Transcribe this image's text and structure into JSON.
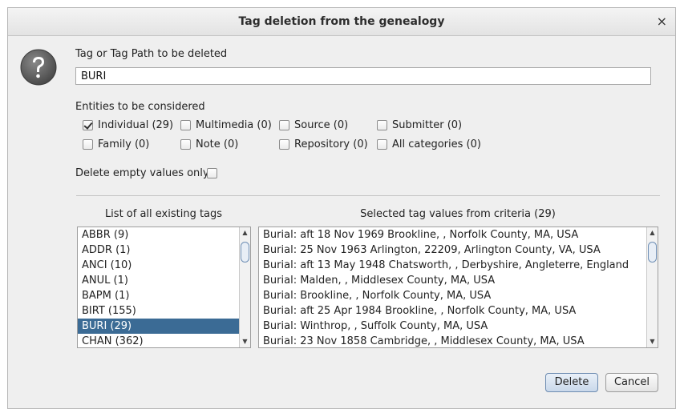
{
  "dialog": {
    "title": "Tag deletion from the genealogy",
    "close_glyph": "×"
  },
  "tag_path": {
    "label": "Tag or Tag Path to be deleted",
    "value": "BURI"
  },
  "entities": {
    "label": "Entities to be considered",
    "options": [
      {
        "label": "Individual (29)",
        "checked": true
      },
      {
        "label": "Multimedia (0)",
        "checked": false
      },
      {
        "label": "Source (0)",
        "checked": false
      },
      {
        "label": "Submitter (0)",
        "checked": false
      },
      {
        "label": "Family (0)",
        "checked": false
      },
      {
        "label": "Note (0)",
        "checked": false
      },
      {
        "label": "Repository (0)",
        "checked": false
      },
      {
        "label": "All categories (0)",
        "checked": false
      }
    ]
  },
  "empty_only": {
    "label": "Delete empty values only",
    "checked": false
  },
  "tags_list": {
    "header": "List of all existing tags",
    "items": [
      "ABBR (9)",
      "ADDR (1)",
      "ANCI (10)",
      "ANUL (1)",
      "BAPM (1)",
      "BIRT (155)",
      "BURI (29)",
      "CHAN (362)"
    ],
    "selected": "BURI (29)"
  },
  "values_list": {
    "header": "Selected tag values from criteria (29)",
    "items": [
      "Burial: aft 18 Nov 1969 Brookline, , Norfolk County, MA, USA",
      "Burial: 25 Nov 1963 Arlington, 22209, Arlington County, VA, USA",
      "Burial: aft 13 May 1948 Chatsworth, , Derbyshire, Angleterre, England",
      "Burial: Malden, , Middlesex County, MA, USA",
      "Burial: Brookline, , Norfolk County, MA, USA",
      "Burial: aft 25 Apr 1984 Brookline, , Norfolk County, MA, USA",
      "Burial: Winthrop, , Suffolk County, MA, USA",
      "Burial: 23 Nov 1858 Cambridge, , Middlesex County, MA, USA"
    ]
  },
  "buttons": {
    "delete": "Delete",
    "cancel": "Cancel"
  },
  "icons": {
    "help": "question-icon",
    "close": "close-icon"
  }
}
